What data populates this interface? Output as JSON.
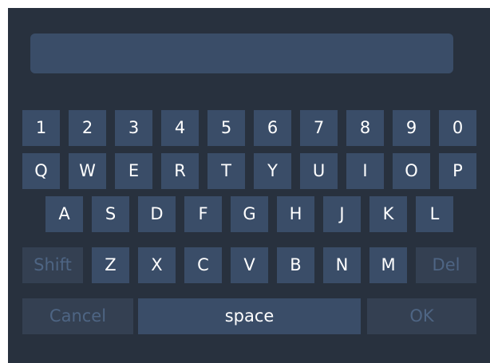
{
  "input": {
    "value": ""
  },
  "keyboard": {
    "number_row": [
      "1",
      "2",
      "3",
      "4",
      "5",
      "6",
      "7",
      "8",
      "9",
      "0"
    ],
    "top_row": [
      "Q",
      "W",
      "E",
      "R",
      "T",
      "Y",
      "U",
      "I",
      "O",
      "P"
    ],
    "home_row": [
      "A",
      "S",
      "D",
      "F",
      "G",
      "H",
      "J",
      "K",
      "L"
    ],
    "bottom_row": {
      "shift": "Shift",
      "letters": [
        "Z",
        "X",
        "C",
        "V",
        "B",
        "N",
        "M"
      ],
      "del": "Del"
    },
    "action_row": {
      "cancel": "Cancel",
      "space": "space",
      "ok": "OK"
    }
  },
  "colors": {
    "panel_background": "#28313e",
    "key_background": "#3a4d68",
    "key_disabled_background": "#344052",
    "key_text": "#ffffff",
    "key_disabled_text": "#4e6584"
  }
}
